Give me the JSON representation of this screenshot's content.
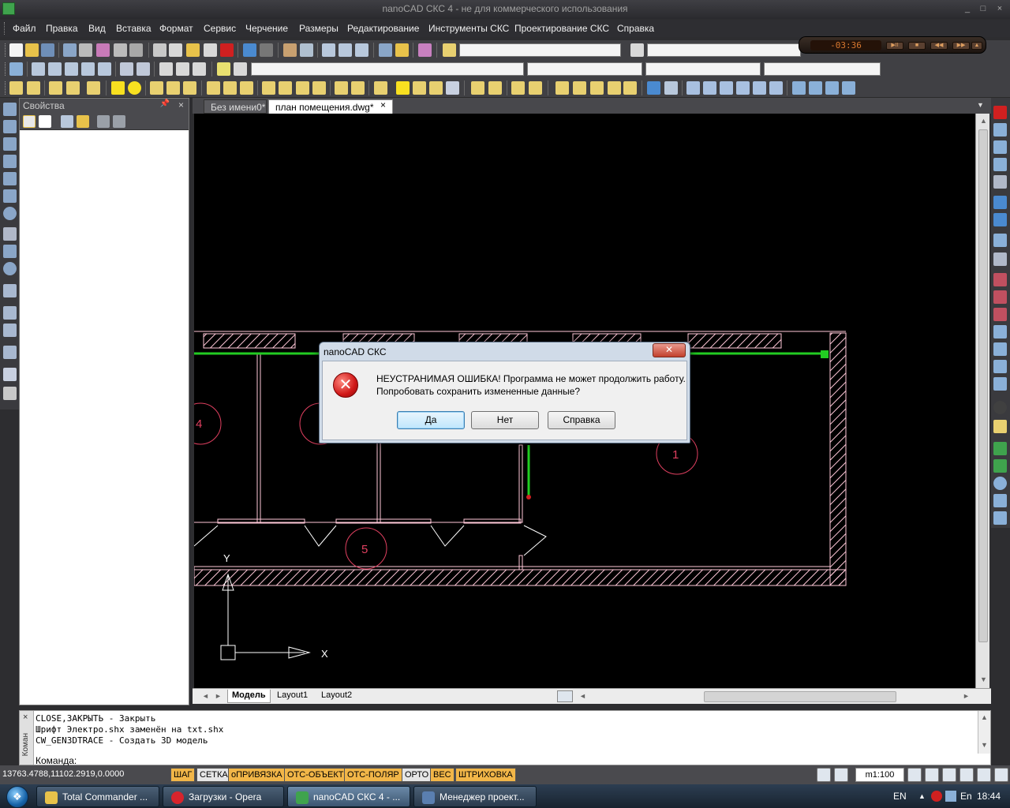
{
  "window": {
    "title": "nanoCAD СКС 4 - не для коммерческого использования",
    "min_glyph": "_",
    "restore_glyph": "□",
    "close_glyph": "×"
  },
  "menu": {
    "items": [
      "Файл",
      "Правка",
      "Вид",
      "Вставка",
      "Формат",
      "Сервис",
      "Черчение",
      "Размеры",
      "Редактирование",
      "Инструменты СКС",
      "Проектирование СКС",
      "Справка"
    ]
  },
  "player": {
    "time": "-03:36",
    "buttons": [
      "▶II",
      "■",
      "◀◀",
      "▶▶",
      "▲"
    ]
  },
  "properties": {
    "title": "Свойства",
    "pin_glyph": "📌",
    "close_glyph": "×"
  },
  "tabs": {
    "items": [
      {
        "label": "Без имени0*"
      },
      {
        "label": "план помещения.dwg*"
      }
    ],
    "close_glyph": "×"
  },
  "drawing": {
    "room_labels": [
      "4",
      "1",
      "5"
    ],
    "axis_y": "Y",
    "axis_x": "X"
  },
  "layouts": {
    "prev_glyph": "◄",
    "next_glyph": "►",
    "items": [
      "Модель",
      "Layout1",
      "Layout2"
    ]
  },
  "command": {
    "side_close": "×",
    "side_label": "Коман",
    "lines": [
      "CLOSE,ЗАКРЫТЬ - Закрыть",
      "Шрифт Электро.shx заменён на txt.shx",
      "CW_GEN3DTRACE - Создать 3D модель"
    ],
    "prompt": "Команда:"
  },
  "status": {
    "coords": "13763.4788,11102.2919,0.0000",
    "toggles": [
      {
        "label": "ШАГ",
        "on": true
      },
      {
        "label": "СЕТКА",
        "on": false
      },
      {
        "label": "оПРИВЯЗКА",
        "on": true
      },
      {
        "label": "ОТС-ОБЪЕКТ",
        "on": true
      },
      {
        "label": "ОТС-ПОЛЯР",
        "on": true
      },
      {
        "label": "ОРТО",
        "on": false
      },
      {
        "label": "ВЕС",
        "on": true
      },
      {
        "label": "ШТРИХОВКА",
        "on": true
      }
    ],
    "scale": "m1:100"
  },
  "dialog": {
    "title": "nanoCAD СКС",
    "close_glyph": "✕",
    "icon_glyph": "✕",
    "message_line1": "НЕУСТРАНИМАЯ ОШИБКА! Программа не может продолжить работу.",
    "message_line2": "Попробовать сохранить измененные данные?",
    "buttons": {
      "yes": "Да",
      "no": "Нет",
      "help": "Справка"
    }
  },
  "taskbar": {
    "tasks": [
      {
        "label": "Total Commander ...",
        "icon_color": "#e8c24a"
      },
      {
        "label": "Загрузки - Opera",
        "icon_color": "#d8242c"
      },
      {
        "label": "nanoCAD СКС 4 - ...",
        "icon_color": "#3fa34d"
      },
      {
        "label": "Менеджер проект...",
        "icon_color": "#5a7fb0"
      }
    ],
    "lang": "EN",
    "lang2": "En",
    "clock": "18:44"
  },
  "colors": {
    "accent_orange": "#f2b648",
    "wall_pink": "#ffc8d8",
    "cable_green": "#22cc22",
    "label_red": "#e04060"
  }
}
